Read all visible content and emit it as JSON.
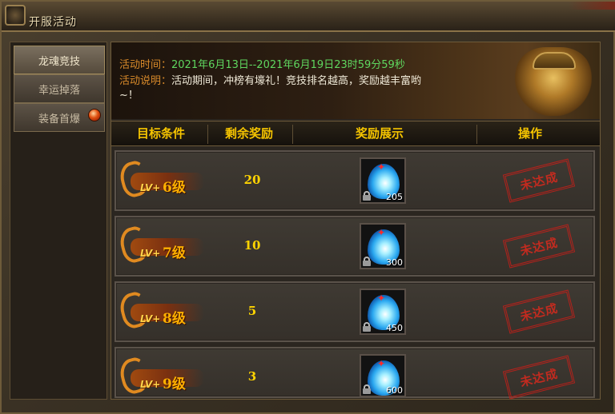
{
  "window": {
    "title": "开服活动"
  },
  "sidebar": {
    "tabs": [
      {
        "label": "龙魂竞技",
        "active": true
      },
      {
        "label": "幸运掉落",
        "active": false
      },
      {
        "label": "装备首爆",
        "active": false,
        "has_notice": true
      }
    ]
  },
  "banner": {
    "time_label": "活动时间：",
    "time_value": "2021年6月13日--2021年6月19日23时59分59秒",
    "desc_label": "活动说明：",
    "desc_value": "活动期间，冲榜有壕礼！竞技排名越高，奖励越丰富哟",
    "desc_cont": "~！"
  },
  "table": {
    "headers": [
      "目标条件",
      "剩余奖励",
      "奖励展示",
      "操作"
    ],
    "rows": [
      {
        "lv_prefix": "LV+",
        "level": "6级",
        "remaining": "20",
        "reward_qty": "205",
        "status": "未达成"
      },
      {
        "lv_prefix": "LV+",
        "level": "7级",
        "remaining": "10",
        "reward_qty": "300",
        "status": "未达成"
      },
      {
        "lv_prefix": "LV+",
        "level": "8级",
        "remaining": "5",
        "reward_qty": "450",
        "status": "未达成"
      },
      {
        "lv_prefix": "LV+",
        "level": "9级",
        "remaining": "3",
        "reward_qty": "600",
        "status": "未达成"
      }
    ]
  },
  "colors": {
    "header_gold": "#f5c400",
    "label_orange": "#d98a2a",
    "time_green": "#5fd75f",
    "stamp_red": "#d02a1e"
  }
}
